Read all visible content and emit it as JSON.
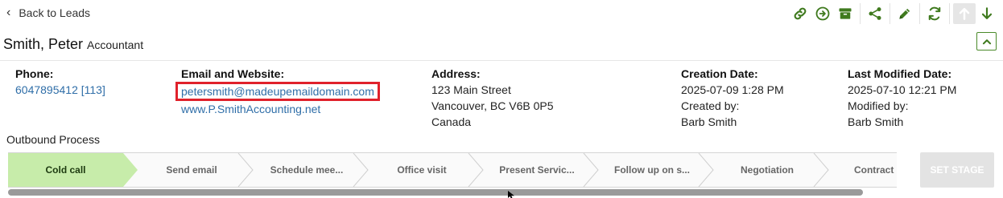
{
  "nav": {
    "back_label": "Back to Leads"
  },
  "toolbar": {
    "icons": [
      "link-icon",
      "arrow-circle-right-icon",
      "archive-icon",
      "share-icon",
      "pencil-icon",
      "refresh-icon",
      "arrow-up-icon",
      "arrow-down-icon"
    ]
  },
  "lead": {
    "name": "Smith, Peter",
    "job_title": "Accountant"
  },
  "details": {
    "phone": {
      "label": "Phone:",
      "value": "6047895412 [113]"
    },
    "email_web": {
      "label": "Email and Website:",
      "email": "petersmith@madeupemaildomain.com",
      "website": "www.P.SmithAccounting.net"
    },
    "address": {
      "label": "Address:",
      "line1": "123 Main Street",
      "line2": "Vancouver, BC V6B 0P5",
      "line3": "Canada"
    },
    "creation": {
      "label": "Creation Date:",
      "value": "2025-07-09 1:28 PM",
      "by_label": "Created by:",
      "by": "Barb Smith"
    },
    "modified": {
      "label": "Last Modified Date:",
      "value": "2025-07-10 12:21 PM",
      "by_label": "Modified by:",
      "by": "Barb Smith"
    }
  },
  "process": {
    "title": "Outbound Process",
    "stages": [
      "Cold call",
      "Send email",
      "Schedule mee...",
      "Office visit",
      "Present Servic...",
      "Follow up on s...",
      "Negotiation",
      "Contract sig"
    ],
    "active_stage": "Cold call",
    "set_stage_label": "SET STAGE"
  },
  "colors": {
    "accent_green": "#3f7a1e",
    "active_stage_fill": "#c7ecaa",
    "highlight_red": "#e0212b",
    "link_blue": "#2f6ea8"
  }
}
